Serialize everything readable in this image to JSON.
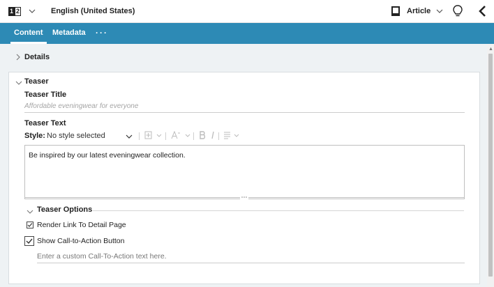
{
  "topbar": {
    "locale_icon": {
      "name": "site-locale-icon",
      "digit_left": "1",
      "digit_right": "2"
    },
    "locale_label": "English (United States)",
    "doc_type_label": "Article",
    "icons": [
      "chevron-down-icon",
      "document-icon",
      "lightbulb-icon",
      "collapse-left-icon"
    ]
  },
  "tabs": [
    {
      "label": "Content",
      "active": true
    },
    {
      "label": "Metadata",
      "active": false
    },
    {
      "label": "···",
      "active": false
    }
  ],
  "details": {
    "label": "Details",
    "expanded": false
  },
  "teaser": {
    "label": "Teaser",
    "expanded": true,
    "title_label": "Teaser Title",
    "title_value": "Affordable eveningwear for everyone",
    "text_label": "Teaser Text",
    "style_label": "Style:",
    "style_value": "No style selected",
    "editor_text": "Be inspired by our latest eveningwear collection.",
    "options": {
      "label": "Teaser Options",
      "render_link": {
        "label": "Render Link To Detail Page",
        "checked": true
      },
      "show_cta": {
        "label": "Show Call-to-Action Button",
        "checked": true
      },
      "cta_placeholder": "Enter a custom Call-To-Action text here."
    }
  },
  "colors": {
    "accent": "#2d8ab5",
    "background": "#eef2f4",
    "panel": "#ffffff"
  }
}
